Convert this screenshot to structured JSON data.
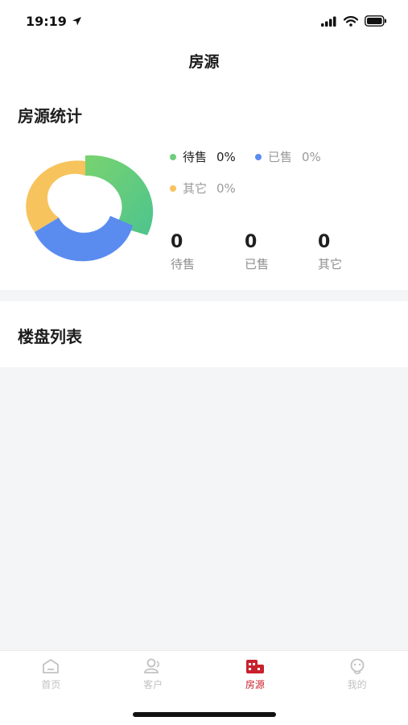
{
  "status_bar": {
    "time": "19:19"
  },
  "nav": {
    "title": "房源"
  },
  "stats": {
    "title": "房源统计",
    "legend": [
      {
        "label": "待售",
        "percent": "0%",
        "color": "#6fce7a"
      },
      {
        "label": "已售",
        "percent": "0%",
        "color": "#5a8cf0"
      },
      {
        "label": "其它",
        "percent": "0%",
        "color": "#f7c35c"
      }
    ],
    "counts": [
      {
        "value": "0",
        "label": "待售"
      },
      {
        "value": "0",
        "label": "已售"
      },
      {
        "value": "0",
        "label": "其它"
      }
    ]
  },
  "list": {
    "title": "楼盘列表"
  },
  "tabbar": {
    "tabs": [
      {
        "label": "首页",
        "icon": "home-icon",
        "active": false
      },
      {
        "label": "客户",
        "icon": "customer-icon",
        "active": false
      },
      {
        "label": "房源",
        "icon": "building-icon",
        "active": true
      },
      {
        "label": "我的",
        "icon": "profile-icon",
        "active": false
      }
    ]
  },
  "colors": {
    "accent": "#c8202c",
    "green": "#6fce7a",
    "blue": "#5a8cf0",
    "yellow": "#f7c35c"
  }
}
